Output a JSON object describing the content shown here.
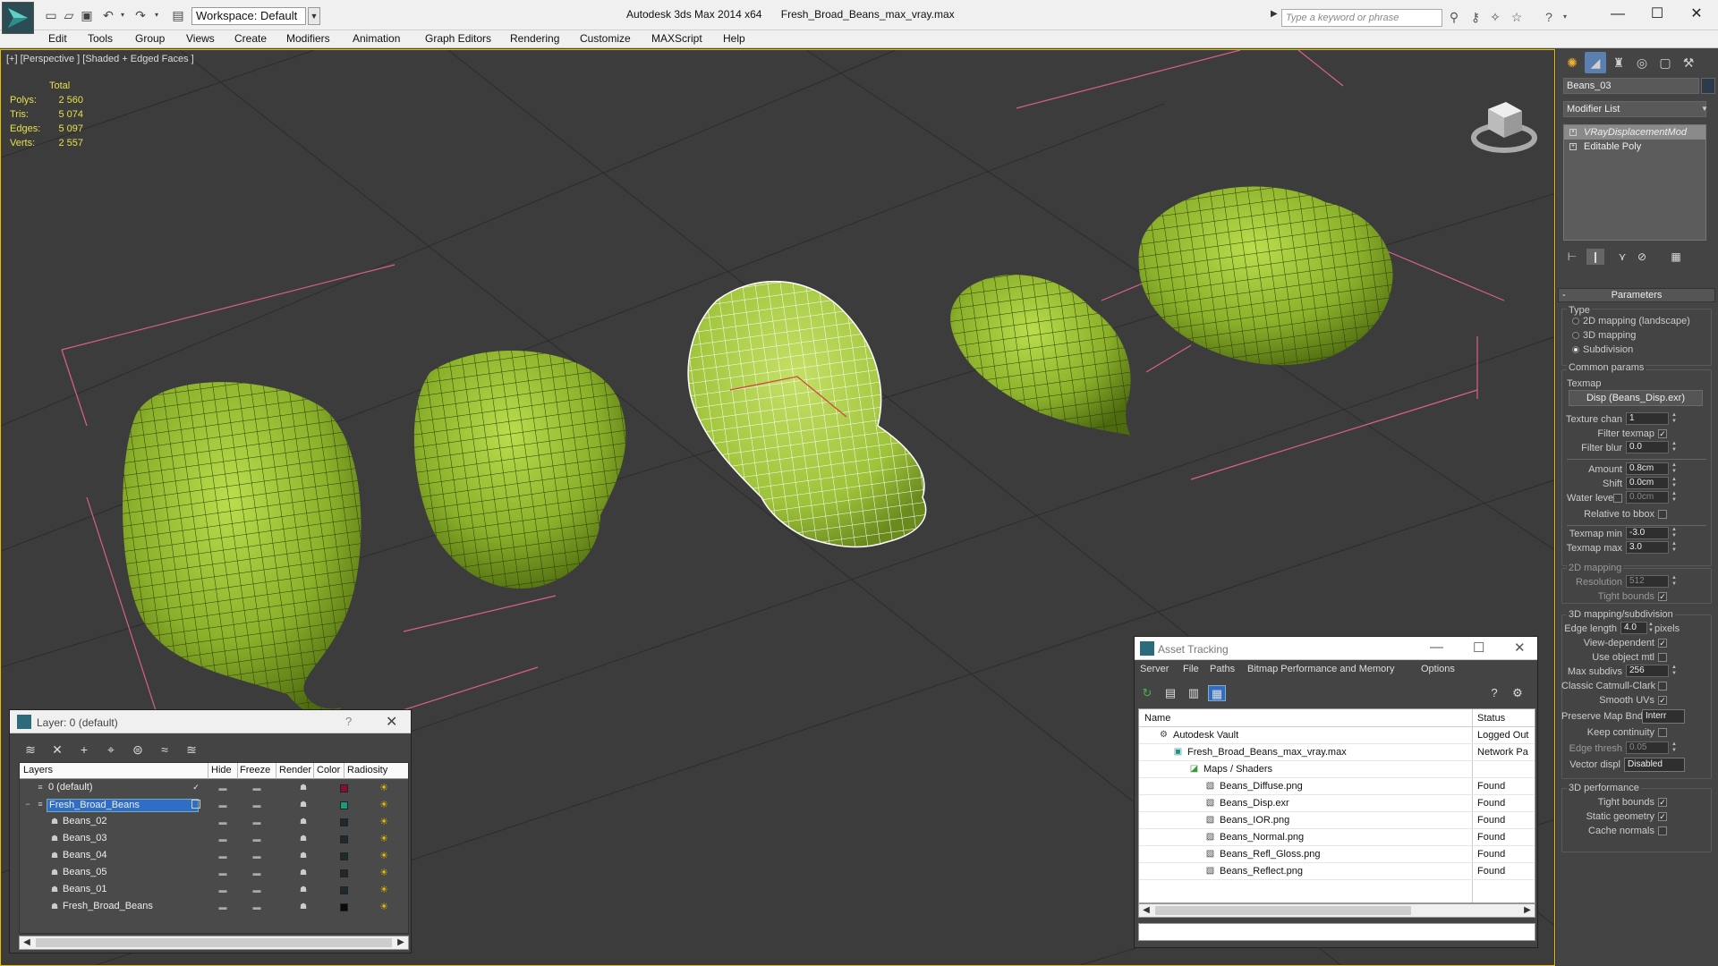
{
  "titlebar": {
    "workspace": "Workspace: Default",
    "app_title": "Autodesk 3ds Max  2014 x64",
    "file_name": "Fresh_Broad_Beans_max_vray.max",
    "search_placeholder": "Type a keyword or phrase"
  },
  "menu": [
    "Edit",
    "Tools",
    "Group",
    "Views",
    "Create",
    "Modifiers",
    "Animation",
    "Graph Editors",
    "Rendering",
    "Customize",
    "MAXScript",
    "Help"
  ],
  "viewport": {
    "label": "[+] [Perspective ] [Shaded + Edged Faces ]",
    "stats": {
      "total_label": "Total",
      "rows": [
        {
          "label": "Polys:",
          "value": "2 560"
        },
        {
          "label": "Tris:",
          "value": "5 074"
        },
        {
          "label": "Edges:",
          "value": "5 097"
        },
        {
          "label": "Verts:",
          "value": "2 557"
        }
      ]
    }
  },
  "command_panel": {
    "object_name": "Beans_03",
    "modifier_list": "Modifier List",
    "stack": [
      "VRayDisplacementMod",
      "Editable Poly"
    ],
    "rollout_title": "Parameters",
    "type_label": "Type",
    "type_options": [
      "2D mapping (landscape)",
      "3D mapping",
      "Subdivision"
    ],
    "common_params": "Common params",
    "texmap_label": "Texmap",
    "texmap_button": "Disp (Beans_Disp.exr)",
    "texture_chan": {
      "label": "Texture chan",
      "value": "1"
    },
    "filter_texmap": "Filter texmap",
    "filter_blur": {
      "label": "Filter blur",
      "value": "0.0"
    },
    "amount": {
      "label": "Amount",
      "value": "0.8cm"
    },
    "shift": {
      "label": "Shift",
      "value": "0.0cm"
    },
    "water_level": {
      "label": "Water level",
      "value": "0.0cm"
    },
    "relative_to_bbox": "Relative to bbox",
    "texmap_min": {
      "label": "Texmap min",
      "value": "-3.0"
    },
    "texmap_max": {
      "label": "Texmap max",
      "value": "3.0"
    },
    "mapping_2d": "2D mapping",
    "resolution": {
      "label": "Resolution",
      "value": "512"
    },
    "tight_bounds_2d": "Tight bounds",
    "mapping_3d": "3D mapping/subdivision",
    "edge_length": {
      "label": "Edge length",
      "value": "4.0",
      "unit": "pixels"
    },
    "view_dependent": "View-dependent",
    "use_object_mtl": "Use object mtl",
    "max_subdivs": {
      "label": "Max subdivs",
      "value": "256"
    },
    "classic_catmull": "Classic Catmull-Clark",
    "smooth_uvs": "Smooth UVs",
    "preserve_map_bnd": {
      "label": "Preserve Map Bnd",
      "value": "Interr"
    },
    "keep_continuity": "Keep continuity",
    "edge_thresh": {
      "label": "Edge thresh",
      "value": "0.05"
    },
    "vector_displ": {
      "label": "Vector displ",
      "value": "Disabled"
    },
    "perf_3d": "3D performance",
    "tight_bounds": "Tight bounds",
    "static_geometry": "Static geometry",
    "cache_normals": "Cache normals"
  },
  "layer_window": {
    "title": "Layer: 0 (default)",
    "help": "?",
    "columns": [
      "Layers",
      "Hide",
      "Freeze",
      "Render",
      "Color",
      "Radiosity"
    ],
    "rows": [
      {
        "name": "0 (default)",
        "color": "#8a1030"
      },
      {
        "name": "Fresh_Broad_Beans",
        "color": "#1a9a7a"
      },
      {
        "name": "Beans_02",
        "color": "#1e2a2e"
      },
      {
        "name": "Beans_03",
        "color": "#1e2a2e"
      },
      {
        "name": "Beans_04",
        "color": "#1e2a2e"
      },
      {
        "name": "Beans_05",
        "color": "#1e2a2e"
      },
      {
        "name": "Beans_01",
        "color": "#1e2a2e"
      },
      {
        "name": "Fresh_Broad_Beans",
        "color": "#0a0a0a"
      }
    ]
  },
  "asset_window": {
    "title": "Asset Tracking",
    "menu": [
      "Server",
      "File",
      "Paths",
      "Bitmap Performance and Memory",
      "Options"
    ],
    "columns": [
      "Name",
      "Status"
    ],
    "rows": [
      {
        "name": "Autodesk Vault",
        "status": "Logged Out"
      },
      {
        "name": "Fresh_Broad_Beans_max_vray.max",
        "status": "Network Pa"
      },
      {
        "name": "Maps / Shaders",
        "status": ""
      },
      {
        "name": "Beans_Diffuse.png",
        "status": "Found"
      },
      {
        "name": "Beans_Disp.exr",
        "status": "Found"
      },
      {
        "name": "Beans_IOR.png",
        "status": "Found"
      },
      {
        "name": "Beans_Normal.png",
        "status": "Found"
      },
      {
        "name": "Beans_Refl_Gloss.png",
        "status": "Found"
      },
      {
        "name": "Beans_Reflect.png",
        "status": "Found"
      }
    ]
  }
}
